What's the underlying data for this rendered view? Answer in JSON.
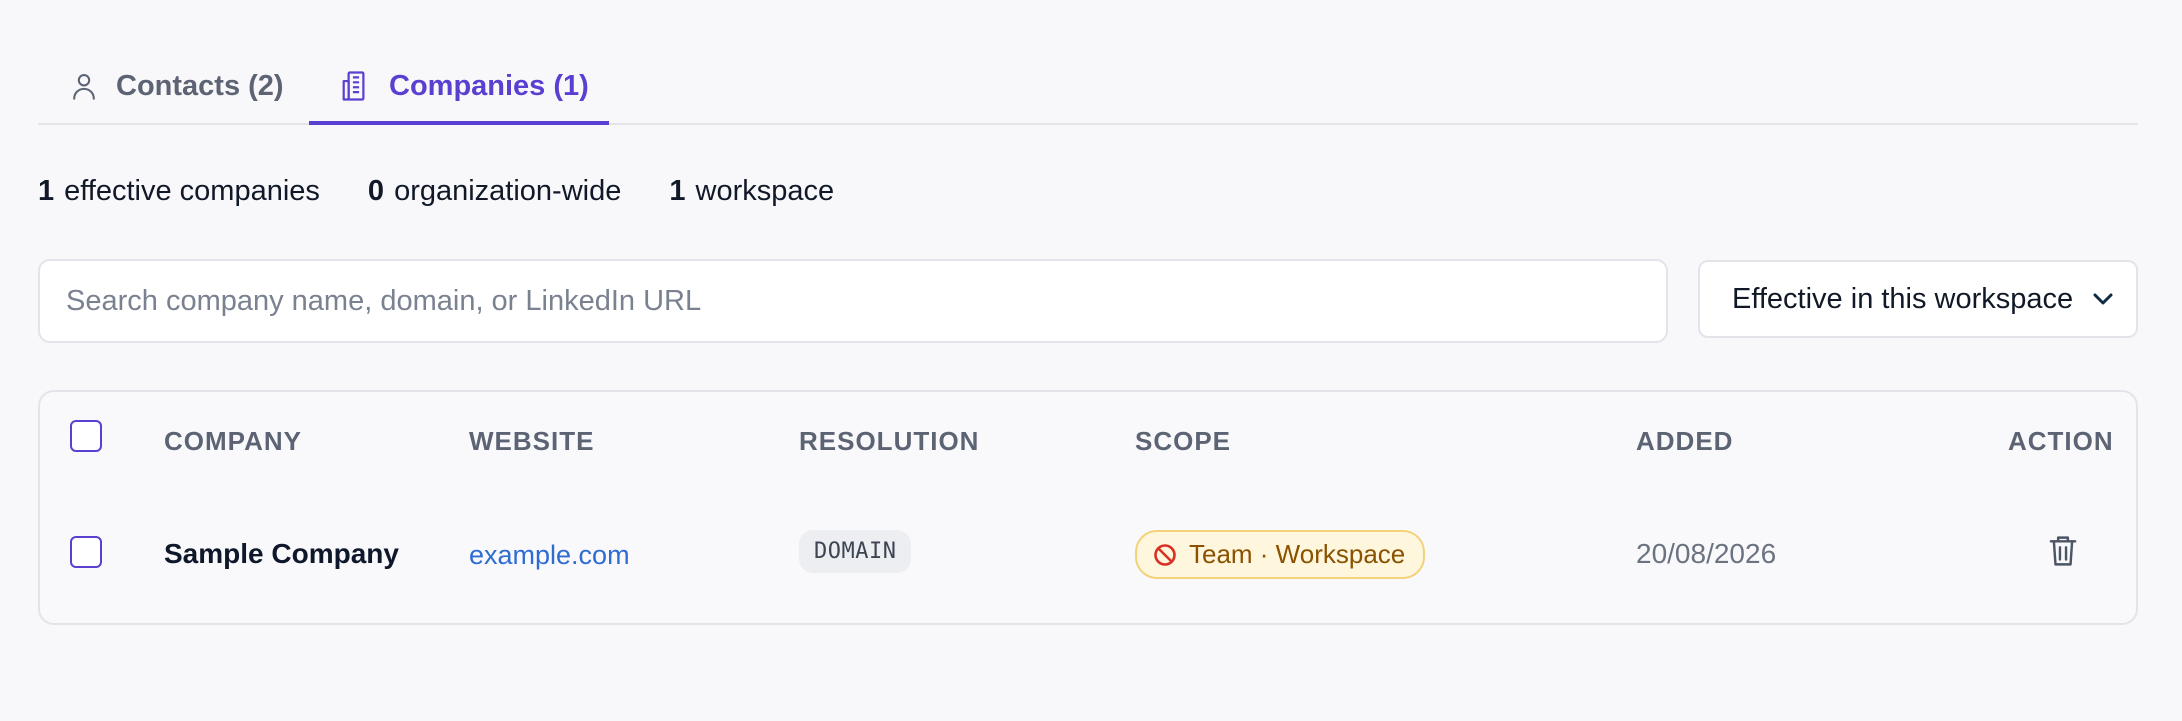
{
  "tabs": [
    {
      "label": "Contacts (2)",
      "icon": "user-icon",
      "active": false
    },
    {
      "label": "Companies (1)",
      "icon": "building-icon",
      "active": true
    }
  ],
  "summary": {
    "effective_count": "1",
    "effective_label": "effective companies",
    "org_count": "0",
    "org_label": "organization-wide",
    "workspace_count": "1",
    "workspace_label": "workspace"
  },
  "search": {
    "placeholder": "Search company name, domain, or LinkedIn URL",
    "value": ""
  },
  "filter": {
    "selected": "Effective in this workspace",
    "icon": "chevron-down-icon"
  },
  "table": {
    "columns": [
      "COMPANY",
      "WEBSITE",
      "RESOLUTION",
      "SCOPE",
      "ADDED",
      "ACTION"
    ],
    "rows": [
      {
        "company": "Sample Company",
        "website": "example.com",
        "resolution": "DOMAIN",
        "scope": "Team · Workspace",
        "scope_icon": "block-icon",
        "added": "20/08/2026",
        "action_icon": "trash-icon"
      }
    ]
  },
  "colors": {
    "accent": "#5b3fd0",
    "link": "#2f6cd2",
    "scope_bg": "#fff7dd",
    "scope_text": "#8a5200",
    "block_red": "#d93025"
  }
}
